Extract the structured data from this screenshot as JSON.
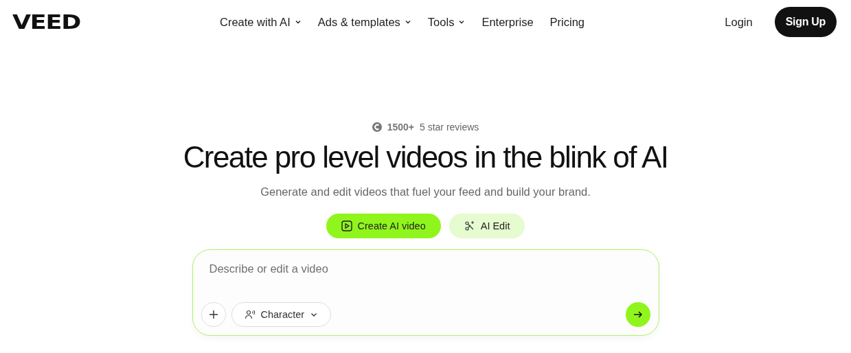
{
  "logo": "VEED",
  "nav": [
    {
      "label": "Create with AI",
      "dropdown": true
    },
    {
      "label": "Ads & templates",
      "dropdown": true
    },
    {
      "label": "Tools",
      "dropdown": true
    },
    {
      "label": "Enterprise",
      "dropdown": false
    },
    {
      "label": "Pricing",
      "dropdown": false
    }
  ],
  "login": "Login",
  "signup": "Sign Up",
  "reviews": {
    "count": "1500+",
    "text": "5 star reviews"
  },
  "headline": "Create pro level videos in the blink of AI",
  "subtitle": "Generate and edit videos that fuel your feed and build your brand.",
  "modes": [
    {
      "label": "Create AI video",
      "kind": "play",
      "selected": true
    },
    {
      "label": "AI Edit",
      "kind": "wand",
      "selected": false
    }
  ],
  "prompt": {
    "placeholder": "Describe or edit a video",
    "character": "Character"
  }
}
